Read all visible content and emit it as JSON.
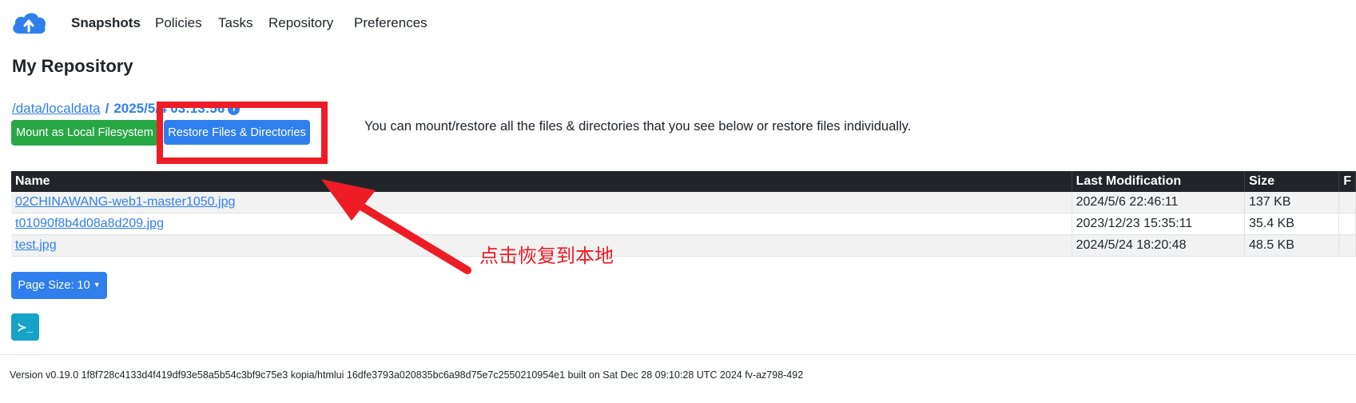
{
  "nav": {
    "items": [
      {
        "label": "Snapshots",
        "active": true
      },
      {
        "label": "Policies"
      },
      {
        "label": "Tasks"
      },
      {
        "label": "Repository"
      },
      {
        "label": "Preferences"
      }
    ],
    "logo_icon": "cloud-upload-icon"
  },
  "page": {
    "title": "My Repository"
  },
  "breadcrumb": {
    "path_link": "/data/localdata",
    "separator": "/",
    "current": "2025/5/4 03:13:56",
    "info_icon": "info-icon"
  },
  "actions": {
    "mount_label": "Mount as Local Filesystem",
    "restore_label": "Restore Files & Directories",
    "hint": "You can mount/restore all the files & directories that you see below or restore files individually."
  },
  "annotation": {
    "text": "点击恢复到本地",
    "color": "#ee1c24"
  },
  "table": {
    "columns": [
      "Name",
      "Last Modification",
      "Size",
      "F"
    ],
    "rows": [
      {
        "name": "02CHINAWANG-web1-master1050.jpg",
        "modified": "2024/5/6 22:46:11",
        "size": "137 KB"
      },
      {
        "name": "t01090f8b4d08a8d209.jpg",
        "modified": "2023/12/23 15:35:11",
        "size": "35.4 KB"
      },
      {
        "name": "test.jpg",
        "modified": "2024/5/24 18:20:48",
        "size": "48.5 KB"
      }
    ]
  },
  "pagination": {
    "page_size_label": "Page Size: 10"
  },
  "terminal": {
    "icon": "terminal-icon",
    "glyph": "≻_"
  },
  "footer": {
    "version": "Version v0.19.0 1f8f728c4133d4f419df93e58a5b54c3bf9c75e3 kopia/htmlui 16dfe3793a020835bc6a98d75e7c2550210954e1 built on Sat Dec 28 09:10:28 UTC 2024 fv-az798-492"
  },
  "colors": {
    "primary": "#2f80ed",
    "success": "#28a745",
    "info": "#17a2c8",
    "table_header": "#212529"
  }
}
